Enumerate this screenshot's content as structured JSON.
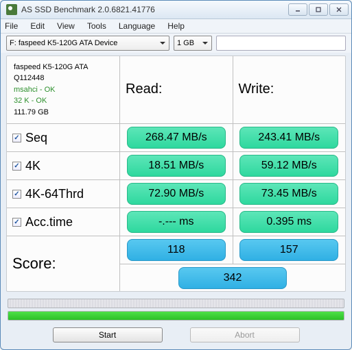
{
  "window": {
    "title": "AS SSD Benchmark 2.0.6821.41776"
  },
  "menu": {
    "file": "File",
    "edit": "Edit",
    "view": "View",
    "tools": "Tools",
    "language": "Language",
    "help": "Help"
  },
  "toolbar": {
    "device": "F: faspeed K5-120G ATA Device",
    "size": "1 GB",
    "search_placeholder": ""
  },
  "info": {
    "model": "faspeed K5-120G ATA",
    "serial": "Q112448",
    "driver": "msahci - OK",
    "align": "32 K - OK",
    "capacity": "111.79 GB"
  },
  "headers": {
    "read": "Read:",
    "write": "Write:"
  },
  "tests": {
    "seq": {
      "label": "Seq",
      "read": "268.47 MB/s",
      "write": "243.41 MB/s"
    },
    "k4": {
      "label": "4K",
      "read": "18.51 MB/s",
      "write": "59.12 MB/s"
    },
    "k4_64": {
      "label": "4K-64Thrd",
      "read": "72.90 MB/s",
      "write": "73.45 MB/s"
    },
    "acc": {
      "label": "Acc.time",
      "read": "-.--- ms",
      "write": "0.395 ms"
    }
  },
  "score": {
    "label": "Score:",
    "read": "118",
    "write": "157",
    "total": "342"
  },
  "buttons": {
    "start": "Start",
    "abort": "Abort"
  }
}
